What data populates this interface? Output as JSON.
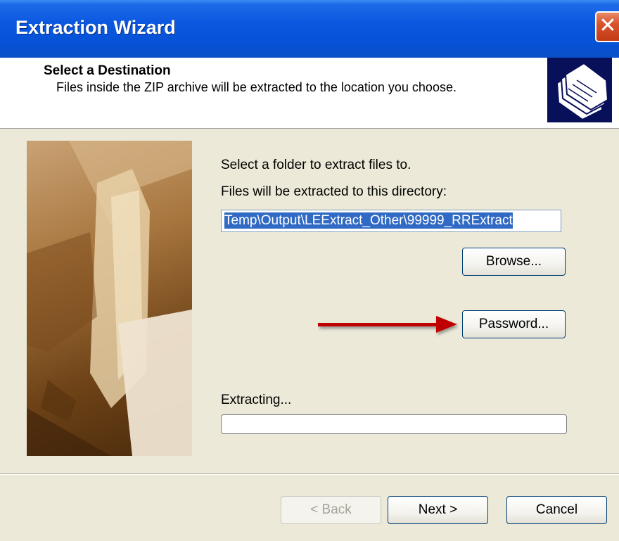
{
  "window": {
    "title": "Extraction Wizard"
  },
  "header": {
    "title": "Select a Destination",
    "description": "Files inside the ZIP archive will be extracted to the location you choose.",
    "icon": "folders-icon"
  },
  "content": {
    "select_folder_label": "Select a folder to extract files to.",
    "directory_label": "Files will be extracted to this directory:",
    "path_value": "Temp\\Output\\LEExtract_Other\\99999_RRExtract",
    "browse_label": "Browse...",
    "password_label": "Password...",
    "extracting_label": "Extracting...",
    "progress_fraction": 0
  },
  "footer": {
    "back_label": "< Back",
    "next_label": "Next >",
    "cancel_label": "Cancel"
  },
  "colors": {
    "titlebar": "#0552d6",
    "arrow": "#c00000",
    "selection": "#316ac5"
  }
}
